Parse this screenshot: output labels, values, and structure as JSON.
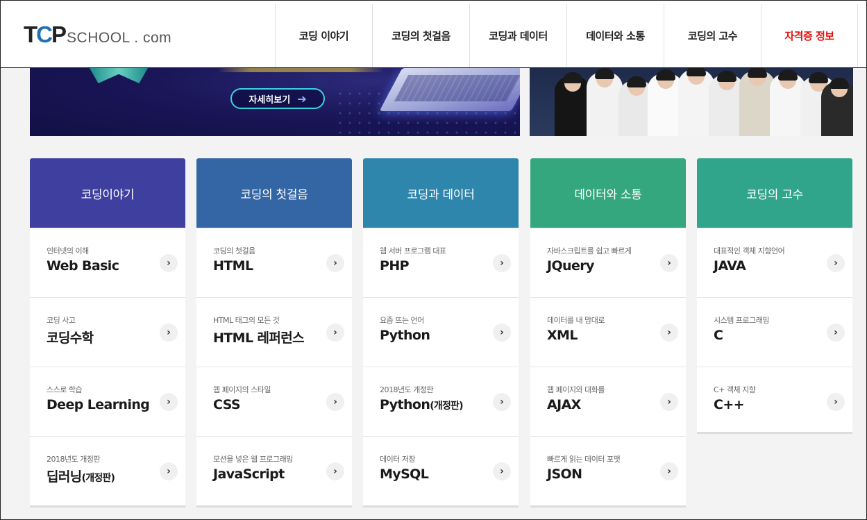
{
  "logo": {
    "tcp_t": "T",
    "tcp_c": "C",
    "tcp_p": "P",
    "school": "SCHOOL . com"
  },
  "nav": [
    {
      "label": "코딩 이야기"
    },
    {
      "label": "코딩의 첫걸음"
    },
    {
      "label": "코딩과 데이터"
    },
    {
      "label": "데이터와 소통"
    },
    {
      "label": "코딩의 고수"
    },
    {
      "label": "자격증 정보"
    }
  ],
  "banner": {
    "detail_label": "자세히보기",
    "detail_icon": "arrow-right-icon"
  },
  "colors": {
    "nav_accent": "#e30f0f",
    "col1": "#3f3f9f",
    "col2": "#3466a6",
    "col3": "#2f86ad",
    "col4": "#34a77f",
    "col5": "#31a48c"
  },
  "columns": [
    {
      "title": "코딩이야기",
      "items": [
        {
          "sub": "인터넷의 이해",
          "title": "Web Basic"
        },
        {
          "sub": "코딩 사고",
          "title": "코딩수학"
        },
        {
          "sub": "스스로 학습",
          "title": "Deep Learning"
        },
        {
          "sub": "2018년도 개정판",
          "title": "딥러닝",
          "suffix": "(개정판)"
        }
      ]
    },
    {
      "title": "코딩의 첫걸음",
      "items": [
        {
          "sub": "코딩의 첫걸음",
          "title": "HTML"
        },
        {
          "sub": "HTML 태그의 모든 것",
          "title": "HTML 레퍼런스"
        },
        {
          "sub": "웹 페이지의 스타일",
          "title": "CSS"
        },
        {
          "sub": "모션을 넣은 웹 프로그래밍",
          "title": "JavaScript"
        }
      ]
    },
    {
      "title": "코딩과 데이터",
      "items": [
        {
          "sub": "웹 서버 프로그램 대표",
          "title": "PHP"
        },
        {
          "sub": "요즘 뜨는 언어",
          "title": "Python"
        },
        {
          "sub": "2018년도 개정판",
          "title": "Python",
          "suffix": "(개정판)"
        },
        {
          "sub": "데이터 저장",
          "title": "MySQL"
        }
      ]
    },
    {
      "title": "데이터와 소통",
      "items": [
        {
          "sub": "자바스크립트를 쉽고 빠르게",
          "title": "JQuery"
        },
        {
          "sub": "데이터를 내 맘대로",
          "title": "XML"
        },
        {
          "sub": "웹 페이지와 대화를",
          "title": "AJAX"
        },
        {
          "sub": "빠르게 읽는 데이터 포맷",
          "title": "JSON"
        }
      ]
    },
    {
      "title": "코딩의 고수",
      "items": [
        {
          "sub": "대표적인 객체 지향언어",
          "title": "JAVA"
        },
        {
          "sub": "시스템 프로그래밍",
          "title": "C"
        },
        {
          "sub": "C+ 객체 지향",
          "title": "C++"
        }
      ]
    }
  ],
  "item_arrow": "›"
}
